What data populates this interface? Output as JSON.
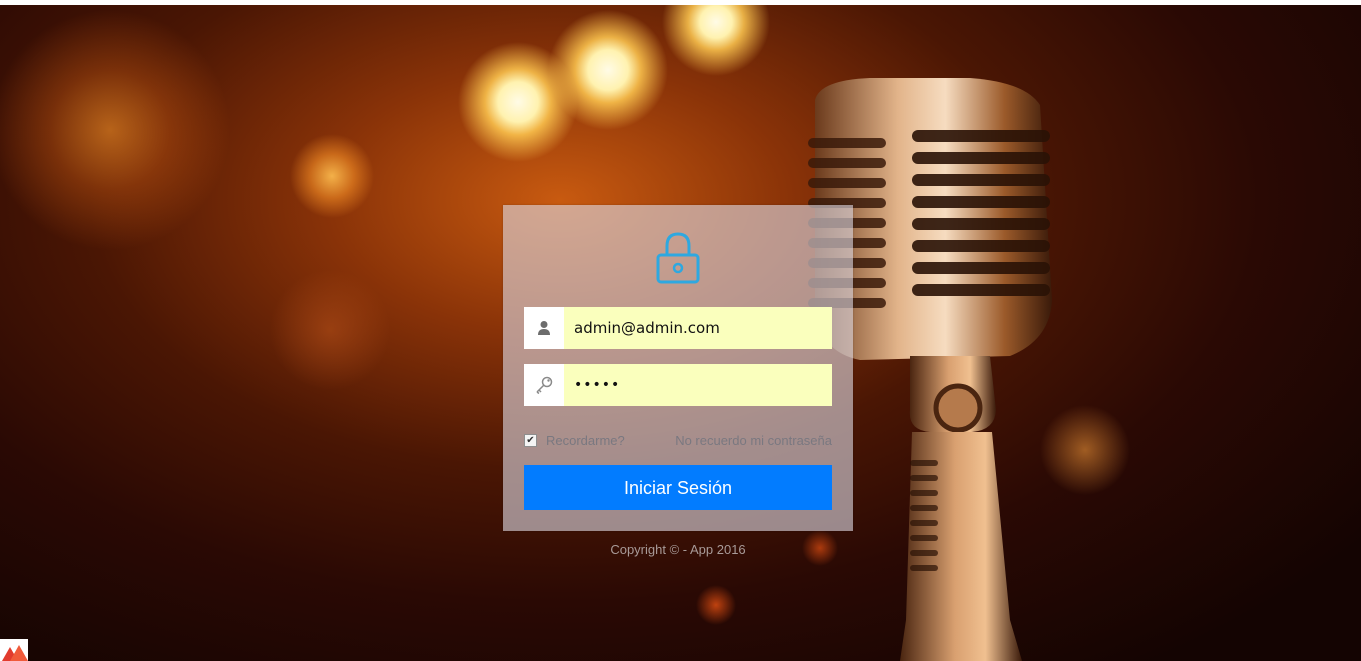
{
  "login": {
    "email_value": "admin@admin.com",
    "password_value": "•••••",
    "remember_label": "Recordarme?",
    "remember_checked": true,
    "forgot_label": "No recuerdo mi contraseña",
    "submit_label": "Iniciar Sesión"
  },
  "footer": {
    "copyright": "Copyright © - App 2016"
  },
  "icons": {
    "lock": "lock-icon",
    "user": "user-icon",
    "key": "key-icon"
  },
  "colors": {
    "accent_button": "#027cff",
    "lock_icon": "#2ea8e0",
    "autofill_bg": "#faffbd"
  }
}
